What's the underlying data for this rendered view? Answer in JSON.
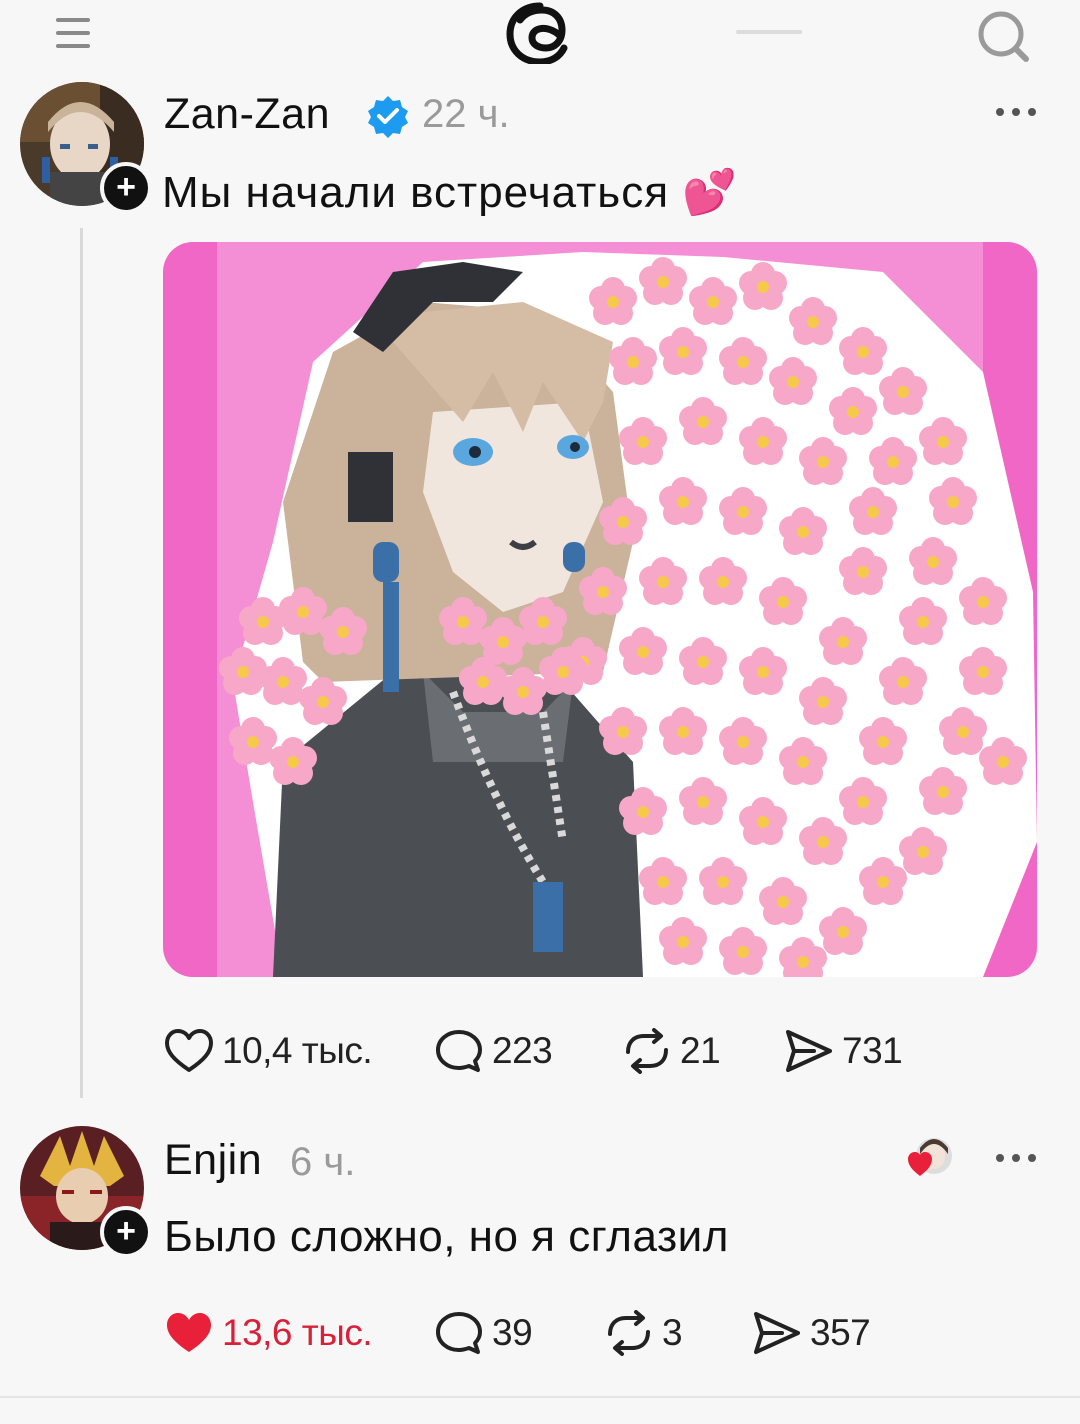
{
  "header": {
    "menu_icon": "menu-icon",
    "logo_icon": "threads-logo-icon",
    "search_icon": "search-icon"
  },
  "post": {
    "username": "Zan-Zan",
    "verified_icon": "verified-badge-icon",
    "time": "22 ч.",
    "text": "Мы начали встречаться 💕",
    "image_icon": "anime-flowers-illustration",
    "actions": {
      "likes": "10,4 тыс.",
      "comments": "223",
      "reposts": "21",
      "shares": "731"
    }
  },
  "reply": {
    "username": "Enjin",
    "time": "6 ч.",
    "text": "Было сложно, но я сглазил",
    "actions": {
      "likes": "13,6 тыс.",
      "comments": "39",
      "reposts": "3",
      "shares": "357"
    }
  },
  "colors": {
    "accent_like": "#e8203a",
    "verified": "#1d9bf0",
    "image_bg": "#f067c6"
  }
}
